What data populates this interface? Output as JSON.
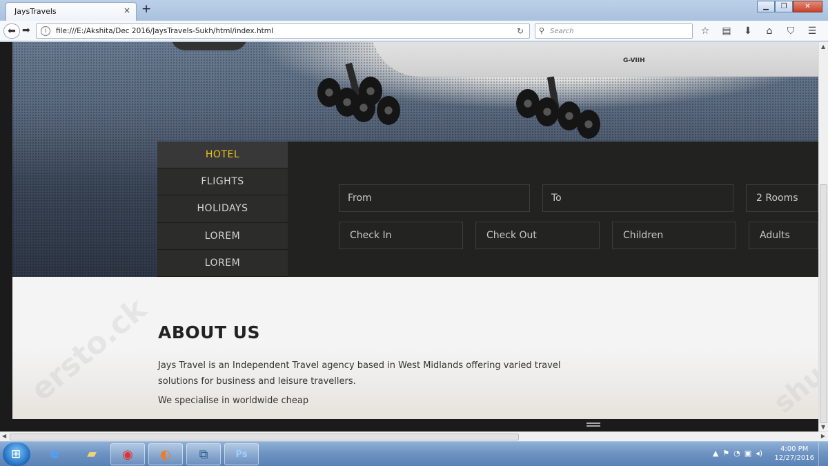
{
  "browser": {
    "tab_title": "JaysTravels",
    "tab_close": "×",
    "new_tab": "+",
    "url": "file:///E:/Akshita/Dec 2016/JaysTravels-Sukh/html/index.html",
    "search_placeholder": "Search",
    "window_buttons": {
      "minimize": "▁",
      "maximize": "❐",
      "close": "✕"
    }
  },
  "hero": {
    "aircraft_registration": "G-VIIH"
  },
  "search_panel": {
    "tabs": [
      {
        "label": "HOTEL",
        "active": true
      },
      {
        "label": "FLIGHTS",
        "active": false
      },
      {
        "label": "HOLIDAYS",
        "active": false
      },
      {
        "label": "LOREM",
        "active": false
      },
      {
        "label": "LOREM",
        "active": false
      }
    ],
    "fields": {
      "from": "From",
      "to": "To",
      "rooms": "2 Rooms",
      "check_in": "Check In",
      "check_out": "Check Out",
      "children": "Children",
      "adults": "Adults"
    },
    "active_color": "#e9c320"
  },
  "about": {
    "title": "ABOUT US",
    "paragraph1": "Jays Travel is an Independent Travel agency based in West Midlands offering varied travel solutions for business and leisure travellers.",
    "paragraph2": "We specialise in worldwide cheap"
  },
  "taskbar": {
    "clock_time": "4:00 PM",
    "clock_date": "12/27/2016"
  }
}
